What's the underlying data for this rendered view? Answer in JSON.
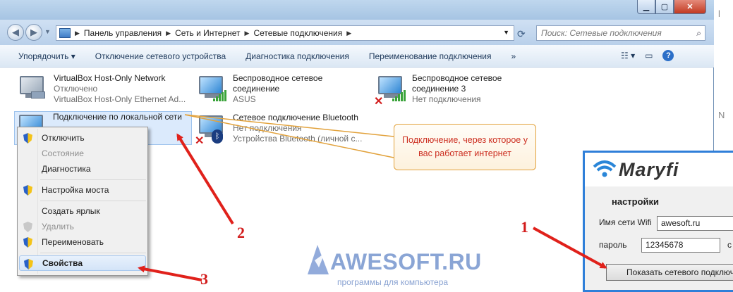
{
  "window": {
    "controls": {
      "minimize": "▁",
      "maximize": "▢",
      "close": "✕"
    },
    "side_letters": [
      "l",
      "N"
    ]
  },
  "address": {
    "breadcrumbs": [
      "Панель управления",
      "Сеть и Интернет",
      "Сетевые подключения"
    ],
    "search_placeholder": "Поиск: Сетевые подключения"
  },
  "toolbar": {
    "items": [
      "Упорядочить ▾",
      "Отключение сетевого устройства",
      "Диагностика подключения",
      "Переименование подключения",
      "»"
    ]
  },
  "connections": [
    {
      "name": "VirtualBox Host-Only Network",
      "status": "Отключено",
      "device": "VirtualBox Host-Only Ethernet Ad..."
    },
    {
      "name": "Беспроводное сетевое соединение",
      "status": "ASUS",
      "device": ""
    },
    {
      "name": "Беспроводное сетевое соединение 3",
      "status": "Нет подключения",
      "device": ""
    },
    {
      "name": "Подключение по локальной сети",
      "status": "",
      "device": ""
    },
    {
      "name": "Сетевое подключение Bluetooth",
      "status": "Нет подключения",
      "device": "Устройства Bluetooth (личной с..."
    }
  ],
  "context_menu": {
    "items": [
      "Отключить",
      "Состояние",
      "Диагностика",
      "Настройка моста",
      "Создать ярлык",
      "Удалить",
      "Переименовать",
      "Свойства"
    ]
  },
  "callout": {
    "text": "Подключение, через которое у вас работает интернет"
  },
  "maryfi": {
    "brand": "Maryfi",
    "section_title": "настройки",
    "ssid_label": "Имя сети Wifi",
    "ssid_value": "awesoft.ru",
    "password_label": "пароль",
    "password_value": "12345678",
    "extra_char": "c",
    "button_label": "Показать сетевого подключе..."
  },
  "watermark": {
    "title": "AWESOFT.RU",
    "subtitle": "программы для компьютера"
  },
  "annotations": {
    "one": "1",
    "two": "2",
    "three": "3"
  },
  "colors": {
    "arrow": "#e0211b",
    "callout_border": "#e2a23c",
    "maryfi_border": "#2f7fd9"
  }
}
